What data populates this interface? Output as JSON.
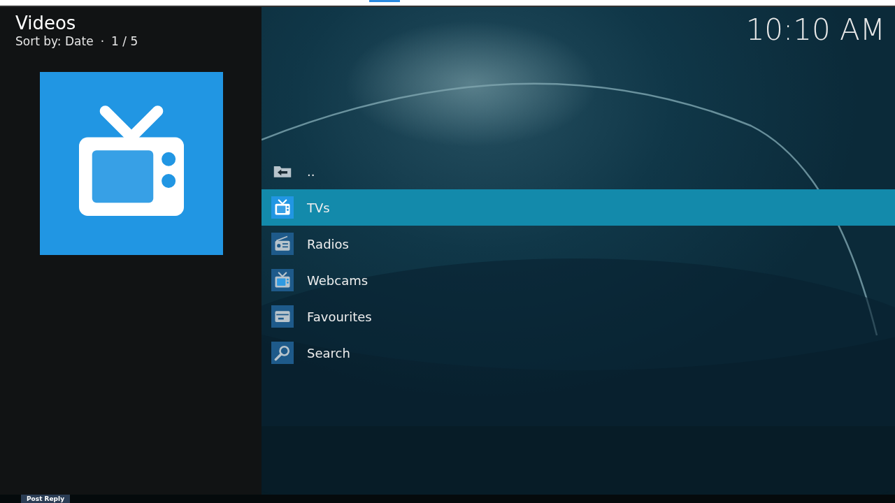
{
  "header": {
    "title": "Videos",
    "sort": "Sort by: Date",
    "separator": "·",
    "position": "1 / 5"
  },
  "clock": "10:10 AM",
  "thumbnail": {
    "kind": "tv"
  },
  "items": [
    {
      "label": "..",
      "kind": "parent",
      "selected": false
    },
    {
      "label": "TVs",
      "kind": "tv",
      "selected": true
    },
    {
      "label": "Radios",
      "kind": "radio",
      "selected": false
    },
    {
      "label": "Webcams",
      "kind": "tv",
      "selected": false
    },
    {
      "label": "Favourites",
      "kind": "favourites",
      "selected": false
    },
    {
      "label": "Search",
      "kind": "search",
      "selected": false
    }
  ],
  "bottom_bar": {
    "button": "Post Reply"
  }
}
